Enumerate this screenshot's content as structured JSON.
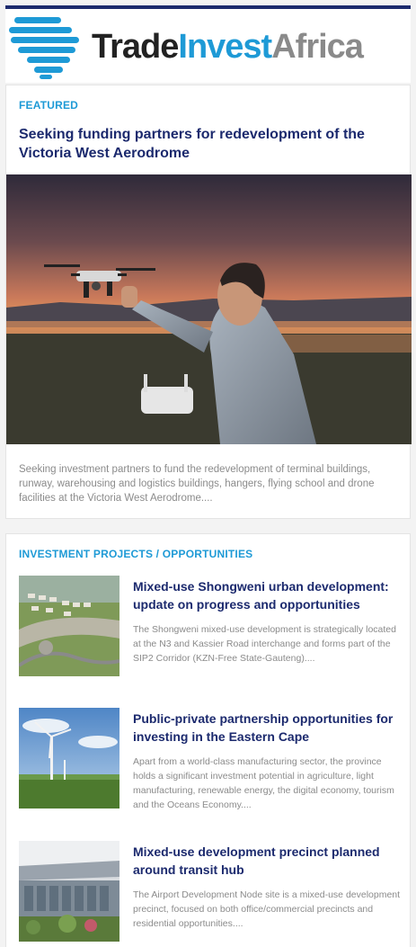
{
  "brand": {
    "name_part1": "Trade",
    "name_part2": "Invest",
    "name_part3": "Africa",
    "colors": {
      "navy": "#1c2a6e",
      "blue": "#1e9ad6",
      "gray": "#8a8a8a"
    }
  },
  "featured": {
    "section_label": "FEATURED",
    "title": "Seeking funding partners for redevelopment of the Victoria West Aerodrome",
    "image_icon": "drone-photo",
    "description": "Seeking investment partners to fund the redevelopment of terminal buildings, runway, warehousing and logistics buildings, hangers, flying school and drone facilities at the Victoria West Aerodrome...."
  },
  "projects": {
    "section_label": "INVESTMENT PROJECTS / OPPORTUNITIES",
    "items": [
      {
        "title": "Mixed-use Shongweni urban development: update on progress and opportunities",
        "description": "The Shongweni mixed-use development is strategically located at the N3 and Kassier Road interchange and forms part of the SIP2 Corridor (KZN-Free State-Gauteng)....",
        "image_icon": "aerial-development-photo"
      },
      {
        "title": "Public-private partnership opportunities for investing in the Eastern Cape",
        "description": "Apart from a world-class manufacturing sector, the province holds a significant investment potential in agriculture, light manufacturing, renewable energy, the digital economy, tourism and the Oceans Economy....",
        "image_icon": "wind-turbine-photo"
      },
      {
        "title": "Mixed-use development precinct planned around transit hub",
        "description": "The Airport Development Node site is a mixed-use development precinct, focused on both office/commercial precincts and residential opportunities....",
        "image_icon": "airport-building-photo"
      }
    ]
  }
}
